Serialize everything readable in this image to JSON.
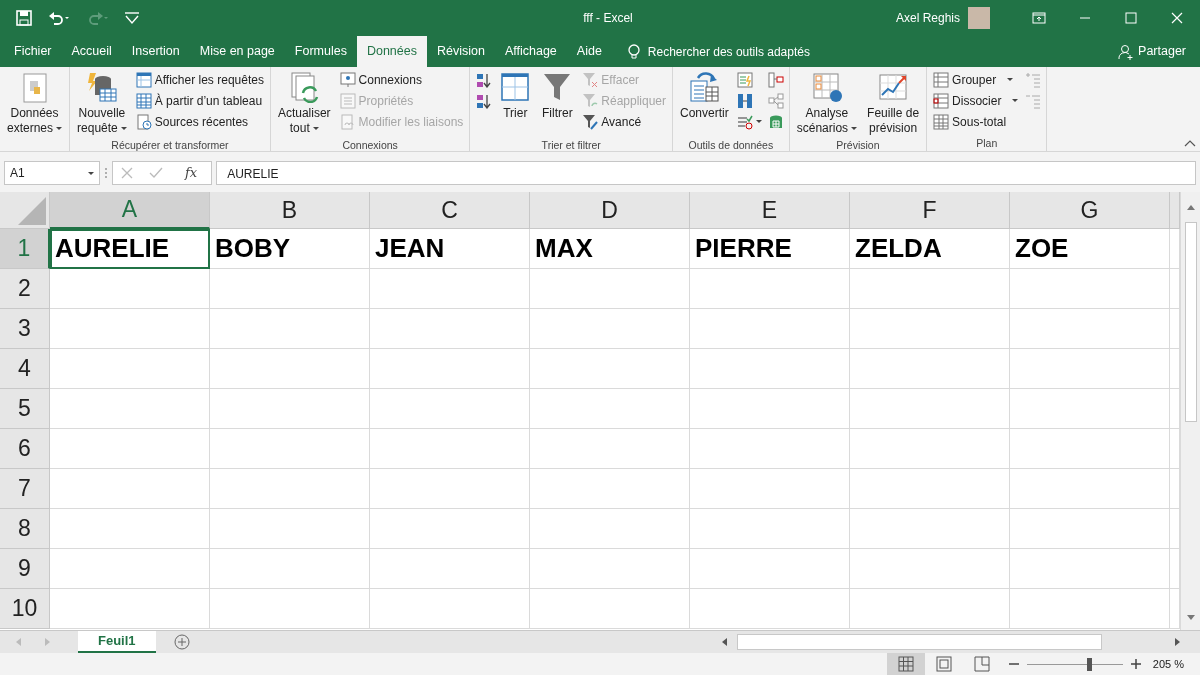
{
  "window": {
    "title": "fff  -  Excel",
    "user": "Axel Reghis"
  },
  "ribbon_tabs": [
    {
      "label": "Fichier",
      "selected": false
    },
    {
      "label": "Accueil",
      "selected": false
    },
    {
      "label": "Insertion",
      "selected": false
    },
    {
      "label": "Mise en page",
      "selected": false
    },
    {
      "label": "Formules",
      "selected": false
    },
    {
      "label": "Données",
      "selected": true
    },
    {
      "label": "Révision",
      "selected": false
    },
    {
      "label": "Affichage",
      "selected": false
    },
    {
      "label": "Aide",
      "selected": false
    }
  ],
  "search": {
    "text": "Rechercher des outils adaptés"
  },
  "share": {
    "label": "Partager"
  },
  "ribbon_groups": [
    {
      "items": [
        {
          "kind": "large",
          "lines": [
            "Données",
            "externes"
          ],
          "dropdown": true
        }
      ]
    },
    {
      "label": "Récupérer et transformer",
      "items": [
        {
          "kind": "large",
          "lines": [
            "Nouvelle",
            "requête"
          ],
          "dropdown": true
        },
        {
          "kind": "stack",
          "entries": [
            {
              "label": "Afficher les requêtes",
              "disabled": false,
              "dropdown": false
            },
            {
              "label": "À partir d’un tableau",
              "disabled": false,
              "dropdown": false
            },
            {
              "label": "Sources récentes",
              "disabled": false,
              "dropdown": false
            }
          ]
        }
      ]
    },
    {
      "label": "Connexions",
      "items": [
        {
          "kind": "large",
          "lines": [
            "Actualiser",
            "tout"
          ],
          "dropdown": true
        },
        {
          "kind": "stack",
          "entries": [
            {
              "label": "Connexions",
              "disabled": false,
              "dropdown": false
            },
            {
              "label": "Propriétés",
              "disabled": true,
              "dropdown": false
            },
            {
              "label": "Modifier les liaisons",
              "disabled": true,
              "dropdown": false
            }
          ]
        }
      ]
    },
    {
      "label": "Trier et filtrer",
      "items": [
        {
          "kind": "tools",
          "tools": [
            {
              "kind": "ascending"
            },
            {
              "kind": "descending"
            }
          ]
        },
        {
          "kind": "large",
          "lines": [
            "Trier"
          ],
          "dropdown": false
        },
        {
          "kind": "large",
          "lines": [
            "Filtrer"
          ],
          "dropdown": false
        },
        {
          "kind": "stack",
          "entries": [
            {
              "label": "Effacer",
              "disabled": true,
              "dropdown": false
            },
            {
              "label": "Réappliquer",
              "disabled": true,
              "dropdown": false
            },
            {
              "label": "Avancé",
              "disabled": false,
              "dropdown": false
            }
          ]
        }
      ]
    },
    {
      "label": "Outils de données",
      "items": [
        {
          "kind": "large",
          "lines": [
            "Convertir"
          ],
          "dropdown": false
        },
        {
          "kind": "tools",
          "tools": [
            {
              "kind": "flashfill"
            },
            {
              "kind": "duplicates"
            },
            {
              "kind": "validation"
            }
          ]
        },
        {
          "kind": "tools",
          "tools": [
            {
              "kind": "consolidate"
            },
            {
              "kind": "relations"
            },
            {
              "kind": "model"
            }
          ]
        }
      ]
    },
    {
      "label": "Prévision",
      "items": [
        {
          "kind": "large",
          "lines": [
            "Analyse",
            "scénarios"
          ],
          "dropdown": true
        },
        {
          "kind": "large",
          "lines": [
            "Feuille de",
            "prévision"
          ],
          "dropdown": false
        }
      ]
    },
    {
      "label": "Plan",
      "items": [
        {
          "kind": "stack",
          "entries": [
            {
              "label": "Grouper",
              "disabled": false,
              "dropdown": true
            },
            {
              "label": "Dissocier",
              "disabled": false,
              "dropdown": true
            },
            {
              "label": "Sous-total",
              "disabled": false,
              "dropdown": false
            }
          ]
        },
        {
          "kind": "tools",
          "tools": [
            {
              "kind": "expand"
            },
            {
              "kind": "collapse"
            }
          ]
        }
      ]
    }
  ],
  "formula_bar": {
    "name_box": "A1",
    "function_button": "fx",
    "value": "AURELIE"
  },
  "sheet": {
    "columns": [
      {
        "label": "A",
        "selected": true
      },
      {
        "label": "B",
        "selected": false
      },
      {
        "label": "C",
        "selected": false
      },
      {
        "label": "D",
        "selected": false
      },
      {
        "label": "E",
        "selected": false
      },
      {
        "label": "F",
        "selected": false
      },
      {
        "label": "G",
        "selected": false
      }
    ],
    "rows": [
      {
        "label": "1",
        "selected": true,
        "cells": [
          {
            "text": "AURELIE",
            "selected": true
          },
          {
            "text": "BOBY",
            "selected": false
          },
          {
            "text": "JEAN",
            "selected": false
          },
          {
            "text": "MAX",
            "selected": false
          },
          {
            "text": "PIERRE",
            "selected": false
          },
          {
            "text": "ZELDA",
            "selected": false
          },
          {
            "text": "ZOE",
            "selected": false
          }
        ]
      },
      {
        "label": "2",
        "selected": false
      },
      {
        "label": "3",
        "selected": false
      },
      {
        "label": "4",
        "selected": false
      },
      {
        "label": "5",
        "selected": false
      },
      {
        "label": "6",
        "selected": false
      },
      {
        "label": "7",
        "selected": false
      },
      {
        "label": "8",
        "selected": false
      },
      {
        "label": "9",
        "selected": false
      },
      {
        "label": "10",
        "selected": false
      }
    ]
  },
  "sheet_tabs": [
    {
      "label": "Feuil1",
      "selected": true
    }
  ],
  "status_bar": {
    "views": [
      {
        "kind": "normal",
        "selected": true
      },
      {
        "kind": "layout",
        "selected": false
      },
      {
        "kind": "breaks",
        "selected": false
      }
    ],
    "zoom": {
      "level": 0.65,
      "reading": "205 %"
    }
  }
}
